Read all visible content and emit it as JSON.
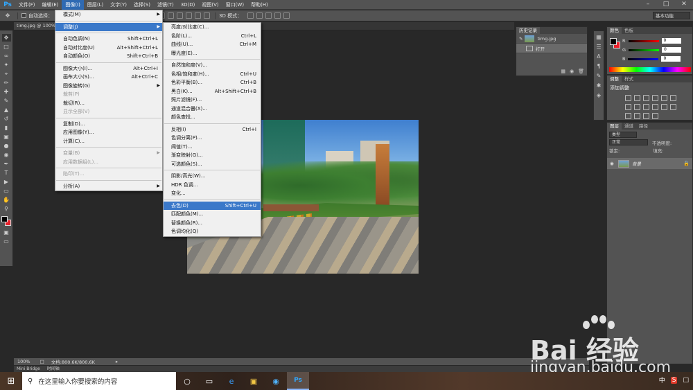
{
  "app": {
    "logo": "Ps",
    "menus": [
      "文件(F)",
      "编辑(E)",
      "图像(I)",
      "图层(L)",
      "文字(Y)",
      "选择(S)",
      "滤镜(T)",
      "3D(D)",
      "视图(V)",
      "窗口(W)",
      "帮助(H)"
    ],
    "active_menu_index": 2
  },
  "options_bar": {
    "auto_select_label": "自动选择：",
    "three_d_mode_label": "3D 模式：",
    "workspace": "基本功能"
  },
  "document": {
    "tab_title": "timg.jpg @ 100%(R",
    "zoom": "100%",
    "doc_info": "文档:800.6K/800.6K"
  },
  "mini_bridge": [
    "Mini Bridge",
    "时间轴"
  ],
  "image_menu": {
    "items": [
      {
        "label": "模式(M)",
        "shortcut": "",
        "submenu": true,
        "disabled": false
      },
      {
        "sep": true
      },
      {
        "label": "调整(J)",
        "shortcut": "",
        "submenu": true,
        "disabled": false,
        "highlight": true
      },
      {
        "sep": true
      },
      {
        "label": "自动色调(N)",
        "shortcut": "Shift+Ctrl+L",
        "disabled": false
      },
      {
        "label": "自动对比度(U)",
        "shortcut": "Alt+Shift+Ctrl+L",
        "disabled": false
      },
      {
        "label": "自动颜色(O)",
        "shortcut": "Shift+Ctrl+B",
        "disabled": false
      },
      {
        "sep": true
      },
      {
        "label": "图像大小(I)...",
        "shortcut": "Alt+Ctrl+I",
        "disabled": false
      },
      {
        "label": "画布大小(S)...",
        "shortcut": "Alt+Ctrl+C",
        "disabled": false
      },
      {
        "label": "图像旋转(G)",
        "shortcut": "",
        "submenu": true,
        "disabled": false
      },
      {
        "label": "裁剪(P)",
        "shortcut": "",
        "disabled": true
      },
      {
        "label": "裁切(R)...",
        "shortcut": "",
        "disabled": false
      },
      {
        "label": "显示全部(V)",
        "shortcut": "",
        "disabled": true
      },
      {
        "sep": true
      },
      {
        "label": "复制(D)...",
        "shortcut": "",
        "disabled": false
      },
      {
        "label": "应用图像(Y)...",
        "shortcut": "",
        "disabled": false
      },
      {
        "label": "计算(C)...",
        "shortcut": "",
        "disabled": false
      },
      {
        "sep": true
      },
      {
        "label": "变量(B)",
        "shortcut": "",
        "submenu": true,
        "disabled": true
      },
      {
        "label": "应用数据组(L)...",
        "shortcut": "",
        "disabled": true
      },
      {
        "sep": true
      },
      {
        "label": "陷印(T)...",
        "shortcut": "",
        "disabled": true
      },
      {
        "sep": true
      },
      {
        "label": "分析(A)",
        "shortcut": "",
        "submenu": true,
        "disabled": false
      }
    ]
  },
  "adjust_menu": {
    "items": [
      {
        "label": "亮度/对比度(C)...",
        "shortcut": ""
      },
      {
        "label": "色阶(L)...",
        "shortcut": "Ctrl+L"
      },
      {
        "label": "曲线(U)...",
        "shortcut": "Ctrl+M"
      },
      {
        "label": "曝光度(E)...",
        "shortcut": ""
      },
      {
        "sep": true
      },
      {
        "label": "自然饱和度(V)...",
        "shortcut": ""
      },
      {
        "label": "色相/饱和度(H)...",
        "shortcut": "Ctrl+U"
      },
      {
        "label": "色彩平衡(B)...",
        "shortcut": "Ctrl+B"
      },
      {
        "label": "黑白(K)...",
        "shortcut": "Alt+Shift+Ctrl+B"
      },
      {
        "label": "照片滤镜(F)...",
        "shortcut": ""
      },
      {
        "label": "通道混合器(X)...",
        "shortcut": ""
      },
      {
        "label": "颜色查找...",
        "shortcut": ""
      },
      {
        "sep": true
      },
      {
        "label": "反相(I)",
        "shortcut": "Ctrl+I"
      },
      {
        "label": "色调分离(P)...",
        "shortcut": ""
      },
      {
        "label": "阈值(T)...",
        "shortcut": ""
      },
      {
        "label": "渐变映射(G)...",
        "shortcut": ""
      },
      {
        "label": "可选颜色(S)...",
        "shortcut": ""
      },
      {
        "sep": true
      },
      {
        "label": "阴影/高光(W)...",
        "shortcut": ""
      },
      {
        "label": "HDR 色调...",
        "shortcut": ""
      },
      {
        "label": "变化...",
        "shortcut": ""
      },
      {
        "sep": true
      },
      {
        "label": "去色(D)",
        "shortcut": "Shift+Ctrl+U",
        "highlight": true
      },
      {
        "label": "匹配颜色(M)...",
        "shortcut": ""
      },
      {
        "label": "替换颜色(R)...",
        "shortcut": ""
      },
      {
        "label": "色调均化(Q)",
        "shortcut": ""
      }
    ]
  },
  "history_panel": {
    "tab": "历史记录",
    "rows": [
      {
        "label": "timg.jpg"
      },
      {
        "label": "打开"
      }
    ]
  },
  "color_panel": {
    "tabs": [
      "颜色",
      "色板"
    ],
    "channels": [
      {
        "name": "R",
        "value": "0",
        "color": "#e8202a"
      },
      {
        "name": "G",
        "value": "0",
        "color": "#20c030"
      },
      {
        "name": "B",
        "value": "0",
        "color": "#2040e0"
      }
    ],
    "foreground": "#000000",
    "background": "#e8202a"
  },
  "adjust_panel": {
    "tabs": [
      "调整",
      "样式"
    ],
    "title": "添加调整"
  },
  "layers_panel": {
    "tabs": [
      "图层",
      "通道",
      "路径"
    ],
    "kind_label": "类型",
    "blend_mode": "正常",
    "opacity_label": "不透明度:",
    "lock_label": "锁定:",
    "fill_label": "填充:",
    "layer_name": "背景"
  },
  "taskbar": {
    "search_placeholder": "在这里输入你要搜索的内容",
    "tray_ime": "中",
    "tray_ime2": "S"
  },
  "watermark": {
    "brand": "Bai 经验",
    "url": "jingyan.baidu.com"
  }
}
